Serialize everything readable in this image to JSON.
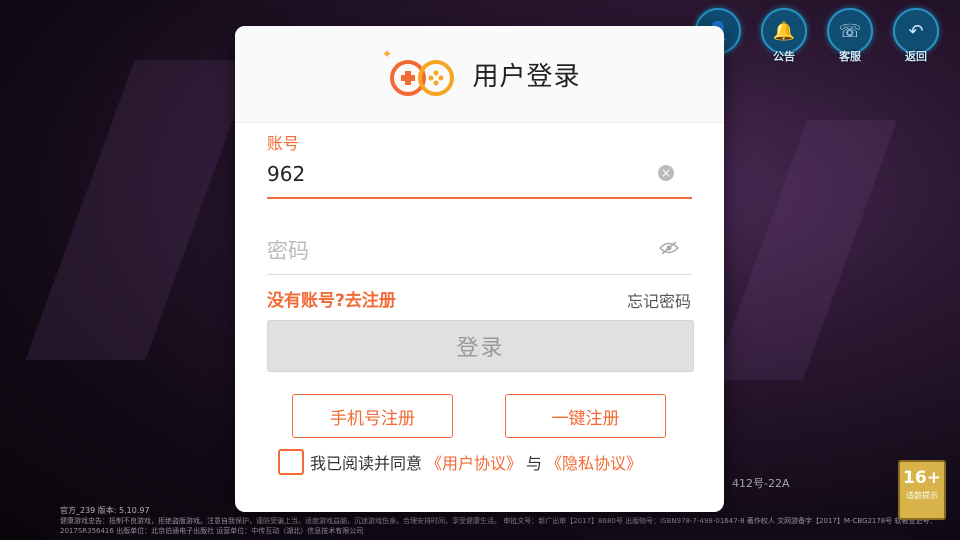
{
  "background": {
    "top_icons": [
      {
        "label": "",
        "icon": "user-icon"
      },
      {
        "label": "公告",
        "icon": "bell-icon"
      },
      {
        "label": "客服",
        "icon": "headset-icon"
      },
      {
        "label": "返回",
        "icon": "back-arrow-icon"
      }
    ],
    "footer_left": "官方_239 版本: 5.10.97",
    "footer_right": "412号-22A",
    "footer_small": "健康游戏忠告：抵制不良游戏，拒绝盗版游戏。注意自我保护，谨防受骗上当。适度游戏益脑，沉迷游戏伤身。合理安排时间，享受健康生活。 审批文号：新广出审【2017】8680号 出版物号：ISBN978-7-498-01647-8 著作权人 文网游备字【2017】M-CBG2178号 软著登记号：2017SR356416 出版单位：北京伯通电子出版社 运营单位：中传互动（湖北）信息技术有限公司",
    "age_badge": {
      "rating": "16+",
      "tip": "适龄提示"
    }
  },
  "dialog": {
    "title": "用户登录",
    "account_label": "账号",
    "account_value": "962",
    "password_placeholder": "密码",
    "register_link": "没有账号?去注册",
    "forgot_link": "忘记密码",
    "login_button": "登录",
    "phone_register_button": "手机号注册",
    "quick_register_button": "一键注册",
    "agree_text": "我已阅读并同意",
    "user_agreement": "《用户协议》",
    "and_text": "与",
    "privacy_agreement": "《隐私协议》"
  },
  "colors": {
    "accent": "#f26a35",
    "disabled_button": "#e0e0e0",
    "icon_blue": "#0f4d73"
  }
}
